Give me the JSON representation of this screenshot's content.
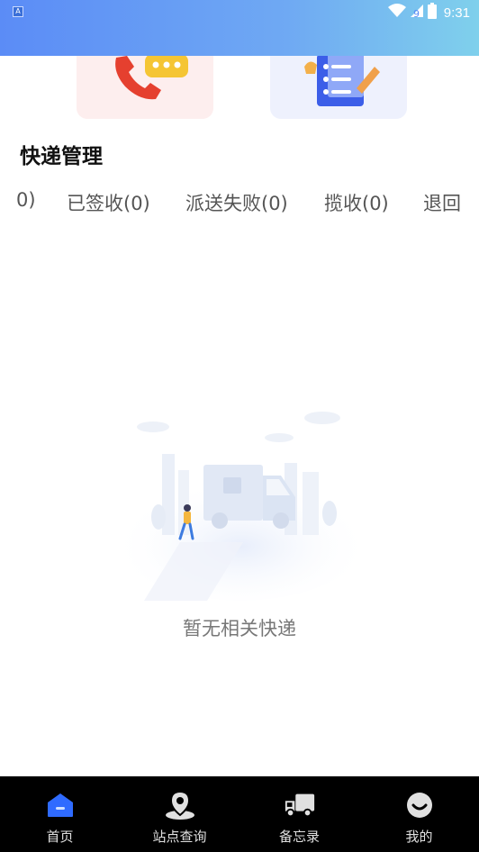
{
  "status_bar": {
    "notification_badge": "A",
    "time": "9:31",
    "battery_level": "9",
    "icons": [
      "wifi-icon",
      "signal-icon",
      "battery-icon"
    ]
  },
  "feature_cards": [
    {
      "icon": "phone-icon",
      "bg": "#fdeeee"
    },
    {
      "icon": "notepad-icon",
      "bg": "#eef1fd"
    }
  ],
  "section": {
    "title": "快递管理"
  },
  "tabs": [
    {
      "label": "0)"
    },
    {
      "label": "已签收(0)"
    },
    {
      "label": "派送失败(0)"
    },
    {
      "label": "揽收(0)"
    },
    {
      "label": "退回"
    }
  ],
  "empty_state": {
    "message": "暂无相关快递"
  },
  "bottom_nav": {
    "active": "首页",
    "items": [
      {
        "label": "首页",
        "icon": "home-icon",
        "color": "#2f6bff"
      },
      {
        "label": "站点查询",
        "icon": "location-icon",
        "color": "#e0e0e0"
      },
      {
        "label": "备忘录",
        "icon": "truck-icon",
        "color": "#e0e0e0"
      },
      {
        "label": "我的",
        "icon": "profile-icon",
        "color": "#e0e0e0"
      }
    ]
  }
}
